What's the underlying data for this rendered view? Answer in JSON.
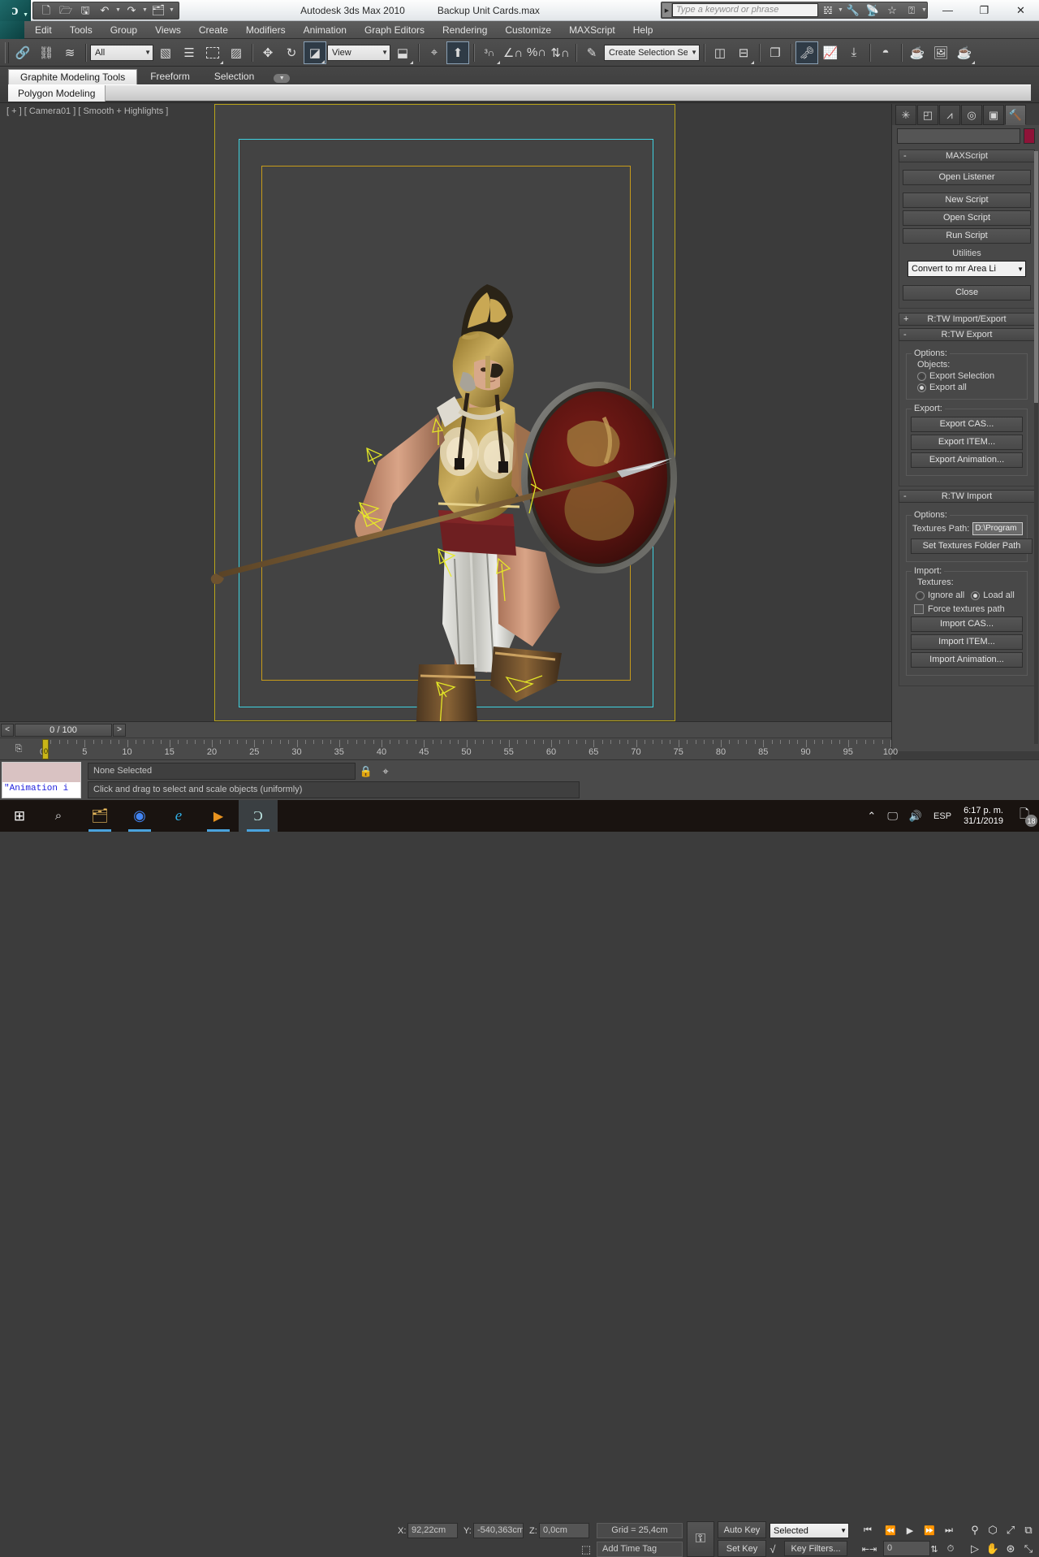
{
  "titlebar": {
    "app_title": "Autodesk 3ds Max  2010",
    "file_title": "Backup Unit Cards.max",
    "logo_glyph": "ɔ",
    "quick_access": [
      {
        "name": "new-file-icon",
        "glyph": "🗋"
      },
      {
        "name": "open-file-icon",
        "glyph": "📂"
      },
      {
        "name": "save-file-icon",
        "glyph": "💾"
      },
      {
        "name": "undo-icon",
        "glyph": "↶"
      },
      {
        "name": "redo-icon",
        "glyph": "↷"
      },
      {
        "name": "project-folder-icon",
        "glyph": "🗂"
      },
      {
        "name": "qat-overflow-icon",
        "glyph": "▼"
      }
    ],
    "search_placeholder": "Type a keyword or phrase",
    "help_icons": [
      {
        "name": "binoculars-icon",
        "glyph": "🔍"
      },
      {
        "name": "wrench-icon",
        "glyph": "🔧"
      },
      {
        "name": "subscription-icon",
        "glyph": "📡"
      },
      {
        "name": "favorites-star-icon",
        "glyph": "☆"
      },
      {
        "name": "help-question-icon",
        "glyph": "?"
      }
    ],
    "window_buttons": [
      {
        "name": "minimize-button",
        "glyph": "—"
      },
      {
        "name": "maximize-button",
        "glyph": "❐"
      },
      {
        "name": "close-button",
        "glyph": "✕"
      }
    ]
  },
  "menubar": {
    "items": [
      "Edit",
      "Tools",
      "Group",
      "Views",
      "Create",
      "Modifiers",
      "Animation",
      "Graph Editors",
      "Rendering",
      "Customize",
      "MAXScript",
      "Help"
    ]
  },
  "toolbar": {
    "left_icons": [
      {
        "name": "select-and-link-icon",
        "glyph": "🔗"
      },
      {
        "name": "unlink-selection-icon",
        "glyph": "✂"
      },
      {
        "name": "bind-to-space-warp-icon",
        "glyph": "≋"
      }
    ],
    "selection_filter": "All",
    "mid_icons": [
      {
        "name": "select-object-icon",
        "glyph": "⬛"
      },
      {
        "name": "select-by-name-icon",
        "glyph": "☰"
      },
      {
        "name": "rectangular-selection-region-icon",
        "glyph": "⬚"
      },
      {
        "name": "window-crossing-icon",
        "glyph": "▧"
      },
      {
        "name": "select-and-move-icon",
        "glyph": "✥"
      },
      {
        "name": "select-and-rotate-icon",
        "glyph": "↻"
      },
      {
        "name": "select-and-scale-icon",
        "glyph": "◥"
      }
    ],
    "reference_coordinate_system": "View",
    "snap_icons": [
      {
        "name": "use-center-flyout-icon",
        "glyph": "⬜"
      },
      {
        "name": "select-and-manipulate-icon",
        "glyph": "⚙"
      },
      {
        "name": "keyboard-shortcut-override-icon",
        "glyph": "⬆"
      },
      {
        "name": "snaps-toggle-3-icon",
        "glyph": "3∩"
      },
      {
        "name": "angle-snap-toggle-icon",
        "glyph": "∠"
      },
      {
        "name": "percent-snap-toggle-icon",
        "glyph": "%"
      },
      {
        "name": "spinner-snap-toggle-icon",
        "glyph": "↕"
      },
      {
        "name": "edit-named-selection-sets-icon",
        "glyph": "✎"
      }
    ],
    "named_selection_set": "Create Selection Se",
    "right_icons": [
      {
        "name": "mirror-icon",
        "glyph": "◑"
      },
      {
        "name": "align-icon",
        "glyph": "⬒"
      },
      {
        "name": "layer-manager-icon",
        "glyph": "🗂"
      },
      {
        "name": "curve-editor-icon",
        "glyph": "📈"
      },
      {
        "name": "schematic-view-icon",
        "glyph": "⬓"
      },
      {
        "name": "material-editor-icon",
        "glyph": "◐"
      },
      {
        "name": "render-setup-icon",
        "glyph": "☕"
      },
      {
        "name": "rendered-frame-window-icon",
        "glyph": "🖼"
      },
      {
        "name": "render-production-icon",
        "glyph": "☕"
      }
    ],
    "toggled_icon_name": "layer-manager-icon"
  },
  "ribbon": {
    "tabs": [
      {
        "label": "Graphite Modeling Tools",
        "active": true
      },
      {
        "label": "Freeform",
        "active": false
      },
      {
        "label": "Selection",
        "active": false
      }
    ],
    "overflow_label": "▼",
    "subtab": "Polygon Modeling"
  },
  "viewport": {
    "label": "[ + ] [ Camera01 ] [ Smooth + Highlights ]",
    "active_border_color": "#b9a419",
    "safe_frame_blue": "#3fd2e0",
    "safe_frame_gold": "#c79b1a"
  },
  "command_panel": {
    "tabs": [
      {
        "name": "create-tab",
        "glyph": "✳"
      },
      {
        "name": "modify-tab",
        "glyph": "◤"
      },
      {
        "name": "hierarchy-tab",
        "glyph": "⑂"
      },
      {
        "name": "motion-tab",
        "glyph": "◎"
      },
      {
        "name": "display-tab",
        "glyph": "⬛"
      },
      {
        "name": "utilities-tab",
        "glyph": "🔨"
      }
    ],
    "active_tab_index": 5,
    "object_name": "",
    "object_color": "#8e1338",
    "maxscript_rollout": {
      "sign": "-",
      "title": "MAXScript",
      "buttons": [
        "Open Listener",
        "New Script",
        "Open Script",
        "Run Script"
      ],
      "utilities_label": "Utilities",
      "utility_selected": "Convert to mr Area Li",
      "close_label": "Close"
    },
    "rtw_importexport_rollout": {
      "sign": "+",
      "title": "R:TW Import/Export"
    },
    "rtw_export_rollout": {
      "sign": "-",
      "title": "R:TW Export",
      "options_group": "Options:",
      "objects_label": "Objects:",
      "radios": [
        {
          "label": "Export Selection",
          "selected": false
        },
        {
          "label": "Export all",
          "selected": true
        }
      ],
      "export_group": "Export:",
      "buttons": [
        "Export CAS...",
        "Export ITEM...",
        "Export Animation..."
      ]
    },
    "rtw_import_rollout": {
      "sign": "-",
      "title": "R:TW Import",
      "options_group": "Options:",
      "textures_path_label": "Textures Path:",
      "textures_path_value": "D:\\Program",
      "set_folder_button": "Set Textures Folder Path",
      "import_group": "Import:",
      "textures_label": "Textures:",
      "radios": [
        {
          "label": "Ignore all",
          "selected": false
        },
        {
          "label": "Load all",
          "selected": true
        }
      ],
      "force_path_label": "Force textures path",
      "force_path_checked": false,
      "buttons": [
        "Import CAS...",
        "Import ITEM...",
        "Import Animation..."
      ]
    }
  },
  "time_slider": {
    "prev_label": "<",
    "value": "0 / 100",
    "next_label": ">"
  },
  "track_bar": {
    "tick_labels": [
      0,
      5,
      10,
      15,
      20,
      25,
      30,
      35,
      40,
      45,
      50,
      55,
      60,
      65,
      70,
      75,
      80,
      85,
      90,
      95,
      100
    ],
    "current_frame_label": "0",
    "range_start": 0,
    "range_end": 100
  },
  "status_bar": {
    "listener_text": "\"Animation i",
    "selection_status": "None Selected",
    "prompt": "Click and drag to select and scale objects (uniformly)",
    "lock_icon": "lock-selection-icon",
    "coord_toggle_icon": "absolute-relative-transform-icon",
    "coords": [
      {
        "label": "X:",
        "value": "92,22cm"
      },
      {
        "label": "Y:",
        "value": "-540,363cm"
      },
      {
        "label": "Z:",
        "value": "0,0cm"
      }
    ],
    "grid_text": "Grid = 25,4cm",
    "add_time_tag": "Add Time Tag",
    "auto_key": "Auto Key",
    "set_key": "Set Key",
    "key_mode": "Selected",
    "key_filters": "Key Filters...",
    "spinner_value": "0",
    "playback_icons": [
      {
        "name": "go-to-start-icon",
        "glyph": "⏮"
      },
      {
        "name": "previous-frame-icon",
        "glyph": "⏪"
      },
      {
        "name": "play-animation-icon",
        "glyph": "▶"
      },
      {
        "name": "next-frame-icon",
        "glyph": "⏩"
      },
      {
        "name": "go-to-end-icon",
        "glyph": "⏭"
      }
    ],
    "view_icons": [
      {
        "name": "zoom-icon",
        "glyph": "⚲"
      },
      {
        "name": "zoom-all-icon",
        "glyph": "⬡"
      },
      {
        "name": "zoom-extents-icon",
        "glyph": "⥁"
      },
      {
        "name": "zoom-region-icon",
        "glyph": "⧉"
      },
      {
        "name": "pan-view-icon",
        "glyph": "✋"
      },
      {
        "name": "orbit-icon",
        "glyph": "⦿"
      },
      {
        "name": "maximize-viewport-icon",
        "glyph": "⤡"
      }
    ],
    "key_tool_icons": [
      {
        "name": "key-mode-toggle-icon",
        "glyph": "⚷"
      },
      {
        "name": "set-key-filters-icon",
        "glyph": "√"
      },
      {
        "name": "time-configuration-icon",
        "glyph": "⏱"
      }
    ]
  },
  "taskbar": {
    "buttons": [
      {
        "name": "start-button",
        "glyph": "⊞"
      },
      {
        "name": "search-button",
        "glyph": "🔍"
      },
      {
        "name": "file-explorer-button",
        "glyph": "📁"
      },
      {
        "name": "chrome-button",
        "glyph": "●"
      },
      {
        "name": "internet-explorer-button",
        "glyph": "e"
      },
      {
        "name": "media-player-button",
        "glyph": "▶"
      },
      {
        "name": "3dsmax-button",
        "glyph": "ɔ"
      }
    ],
    "tray_icons": [
      {
        "name": "show-hidden-icons",
        "glyph": "∧"
      },
      {
        "name": "network-icon",
        "glyph": "🖥"
      },
      {
        "name": "volume-icon",
        "glyph": "🔊"
      }
    ],
    "language": "ESP",
    "time": "6:17 p. m.",
    "date": "31/1/2019",
    "notification_count": "18"
  }
}
